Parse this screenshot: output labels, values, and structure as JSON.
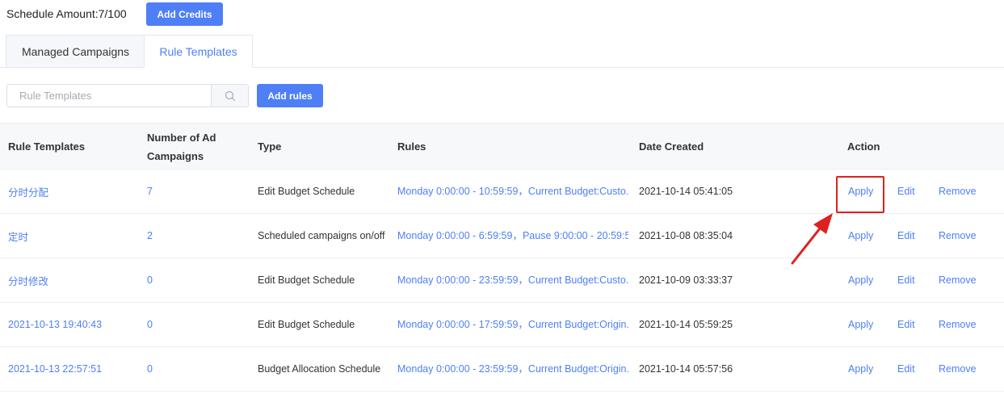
{
  "header": {
    "schedule_amount": "Schedule Amount:7/100",
    "add_credits_label": "Add Credits"
  },
  "tabs": [
    {
      "label": "Managed Campaigns",
      "active": false
    },
    {
      "label": "Rule Templates",
      "active": true
    }
  ],
  "search": {
    "placeholder": "Rule Templates",
    "value": "",
    "icon": "search-icon"
  },
  "toolbar": {
    "add_rules_label": "Add rules"
  },
  "table": {
    "columns": {
      "name": "Rule Templates",
      "count": "Number of Ad Campaigns",
      "type": "Type",
      "rules": "Rules",
      "date": "Date Created",
      "action": "Action"
    },
    "rows": [
      {
        "name": "分时分配",
        "count": "7",
        "type": "Edit Budget Schedule",
        "rules": "Monday 0:00:00 - 10:59:59，Current Budget:Custo...",
        "date": "2021-10-14 05:41:05",
        "apply": "Apply",
        "edit": "Edit",
        "remove": "Remove"
      },
      {
        "name": "定时",
        "count": "2",
        "type": "Scheduled campaigns on/off",
        "rules": "Monday 0:00:00 - 6:59:59，Pause 9:00:00 - 20:59:5...",
        "date": "2021-10-08 08:35:04",
        "apply": "Apply",
        "edit": "Edit",
        "remove": "Remove"
      },
      {
        "name": "分时修改",
        "count": "0",
        "type": "Edit Budget Schedule",
        "rules": "Monday 0:00:00 - 23:59:59，Current Budget:Custo...",
        "date": "2021-10-09 03:33:37",
        "apply": "Apply",
        "edit": "Edit",
        "remove": "Remove"
      },
      {
        "name": "2021-10-13 19:40:43",
        "count": "0",
        "type": "Edit Budget Schedule",
        "rules": "Monday 0:00:00 - 17:59:59，Current Budget:Origin...",
        "date": "2021-10-14 05:59:25",
        "apply": "Apply",
        "edit": "Edit",
        "remove": "Remove"
      },
      {
        "name": "2021-10-13 22:57:51",
        "count": "0",
        "type": "Budget Allocation Schedule",
        "rules": "Monday 0:00:00 - 23:59:59，Current Budget:Origin...",
        "date": "2021-10-14 05:57:56",
        "apply": "Apply",
        "edit": "Edit",
        "remove": "Remove"
      }
    ]
  },
  "colors": {
    "primary": "#4e7ff7",
    "annotation": "#e02020"
  }
}
